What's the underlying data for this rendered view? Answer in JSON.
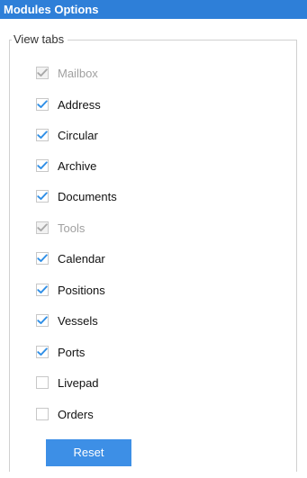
{
  "header": {
    "title": "Modules Options"
  },
  "view_tabs": {
    "legend": "View tabs",
    "options": [
      {
        "label": "Mailbox",
        "checked": true,
        "disabled": true
      },
      {
        "label": "Address",
        "checked": true,
        "disabled": false
      },
      {
        "label": "Circular",
        "checked": true,
        "disabled": false
      },
      {
        "label": "Archive",
        "checked": true,
        "disabled": false
      },
      {
        "label": "Documents",
        "checked": true,
        "disabled": false
      },
      {
        "label": "Tools",
        "checked": true,
        "disabled": true
      },
      {
        "label": "Calendar",
        "checked": true,
        "disabled": false
      },
      {
        "label": "Positions",
        "checked": true,
        "disabled": false
      },
      {
        "label": "Vessels",
        "checked": true,
        "disabled": false
      },
      {
        "label": "Ports",
        "checked": true,
        "disabled": false
      },
      {
        "label": "Livepad",
        "checked": false,
        "disabled": false
      },
      {
        "label": "Orders",
        "checked": false,
        "disabled": false
      }
    ]
  },
  "reset_button": {
    "label": "Reset"
  },
  "colors": {
    "header_bg": "#2e7fd8",
    "check_active": "#2e8ee6",
    "check_disabled": "#a8a8a8",
    "button_bg": "#3d8fe6"
  }
}
